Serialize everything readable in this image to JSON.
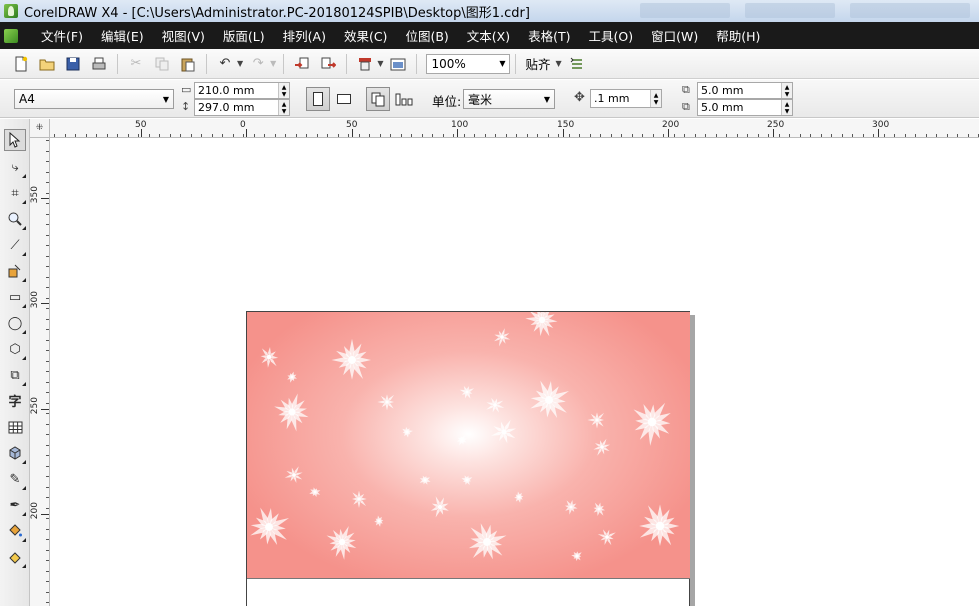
{
  "window": {
    "title": "CorelDRAW X4 - [C:\\Users\\Administrator.PC-20180124SPIB\\Desktop\\图形1.cdr]"
  },
  "menu": [
    "文件(F)",
    "编辑(E)",
    "视图(V)",
    "版面(L)",
    "排列(A)",
    "效果(C)",
    "位图(B)",
    "文本(X)",
    "表格(T)",
    "工具(O)",
    "窗口(W)",
    "帮助(H)"
  ],
  "toolbar": {
    "zoom": "100%",
    "snap_label": "贴齐"
  },
  "property_bar": {
    "paper_preset": "A4",
    "width": "210.0 mm",
    "height": "297.0 mm",
    "units_label": "单位:",
    "units_value": "毫米",
    "nudge": ".1 mm",
    "dup_x": "5.0 mm",
    "dup_y": "5.0 mm"
  },
  "rulers": {
    "horizontal_ticks": [
      "50",
      "0",
      "50",
      "100",
      "150",
      "200",
      "250",
      "300"
    ],
    "vertical_ticks": [
      "350",
      "300",
      "250",
      "200"
    ]
  },
  "toolbox": {
    "text_tool_glyph": "字"
  },
  "colors": {
    "menubar_bg": "#1a1a1a",
    "art_center": "#ffffff",
    "art_edge": "#f5928b"
  }
}
